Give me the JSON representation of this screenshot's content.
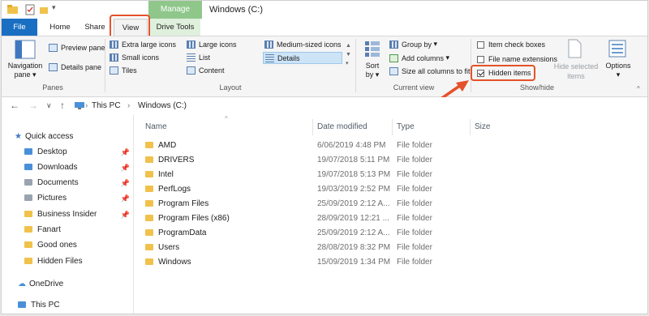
{
  "window": {
    "title": "Windows (C:)"
  },
  "context_tab": "Manage",
  "tabs": [
    "File",
    "Home",
    "Share",
    "View",
    "Drive Tools"
  ],
  "ribbon": {
    "panes": {
      "navigation_pane": "Navigation",
      "navigation_pane_2": "pane",
      "preview_pane": "Preview pane",
      "details_pane": "Details pane",
      "label": "Panes"
    },
    "layout": {
      "items": [
        "Extra large icons",
        "Large icons",
        "Medium-sized icons",
        "Small icons",
        "List",
        "Details",
        "Tiles",
        "Content"
      ],
      "label": "Layout"
    },
    "current_view": {
      "sort_by": "Sort",
      "sort_by_2": "by",
      "group_by": "Group by",
      "add_columns": "Add columns",
      "size_all": "Size all columns to fit",
      "label": "Current view"
    },
    "show_hide": {
      "item_check_boxes": "Item check boxes",
      "file_name_extensions": "File name extensions",
      "hidden_items": "Hidden items",
      "hide_selected": "Hide selected",
      "hide_selected_2": "items",
      "options": "Options",
      "label": "Show/hide",
      "hidden_items_checked": true
    }
  },
  "address": {
    "this_pc": "This PC",
    "location": "Windows (C:)"
  },
  "sidebar": {
    "quick_access": "Quick access",
    "items": [
      {
        "label": "Desktop",
        "pinned": true
      },
      {
        "label": "Downloads",
        "pinned": true
      },
      {
        "label": "Documents",
        "pinned": true
      },
      {
        "label": "Pictures",
        "pinned": true
      },
      {
        "label": "Business Insider",
        "pinned": true
      },
      {
        "label": "Fanart",
        "pinned": false
      },
      {
        "label": "Good ones",
        "pinned": false
      },
      {
        "label": "Hidden Files",
        "pinned": false
      }
    ],
    "onedrive": "OneDrive",
    "this_pc": "This PC"
  },
  "columns": [
    "Name",
    "Date modified",
    "Type",
    "Size"
  ],
  "files": [
    {
      "name": "AMD",
      "date": "6/06/2019 4:48 PM",
      "type": "File folder"
    },
    {
      "name": "DRIVERS",
      "date": "19/07/2018 5:11 PM",
      "type": "File folder"
    },
    {
      "name": "Intel",
      "date": "19/07/2018 5:13 PM",
      "type": "File folder"
    },
    {
      "name": "PerfLogs",
      "date": "19/03/2019 2:52 PM",
      "type": "File folder"
    },
    {
      "name": "Program Files",
      "date": "25/09/2019 2:12 A...",
      "type": "File folder"
    },
    {
      "name": "Program Files (x86)",
      "date": "28/09/2019 12:21 ...",
      "type": "File folder"
    },
    {
      "name": "ProgramData",
      "date": "25/09/2019 2:12 A...",
      "type": "File folder"
    },
    {
      "name": "Users",
      "date": "28/08/2019 8:32 PM",
      "type": "File folder"
    },
    {
      "name": "Windows",
      "date": "15/09/2019 1:34 PM",
      "type": "File folder"
    }
  ],
  "colors": {
    "accent": "#1a6fc2",
    "highlight": "#e5512a",
    "manage_tab": "#8fc78b"
  }
}
